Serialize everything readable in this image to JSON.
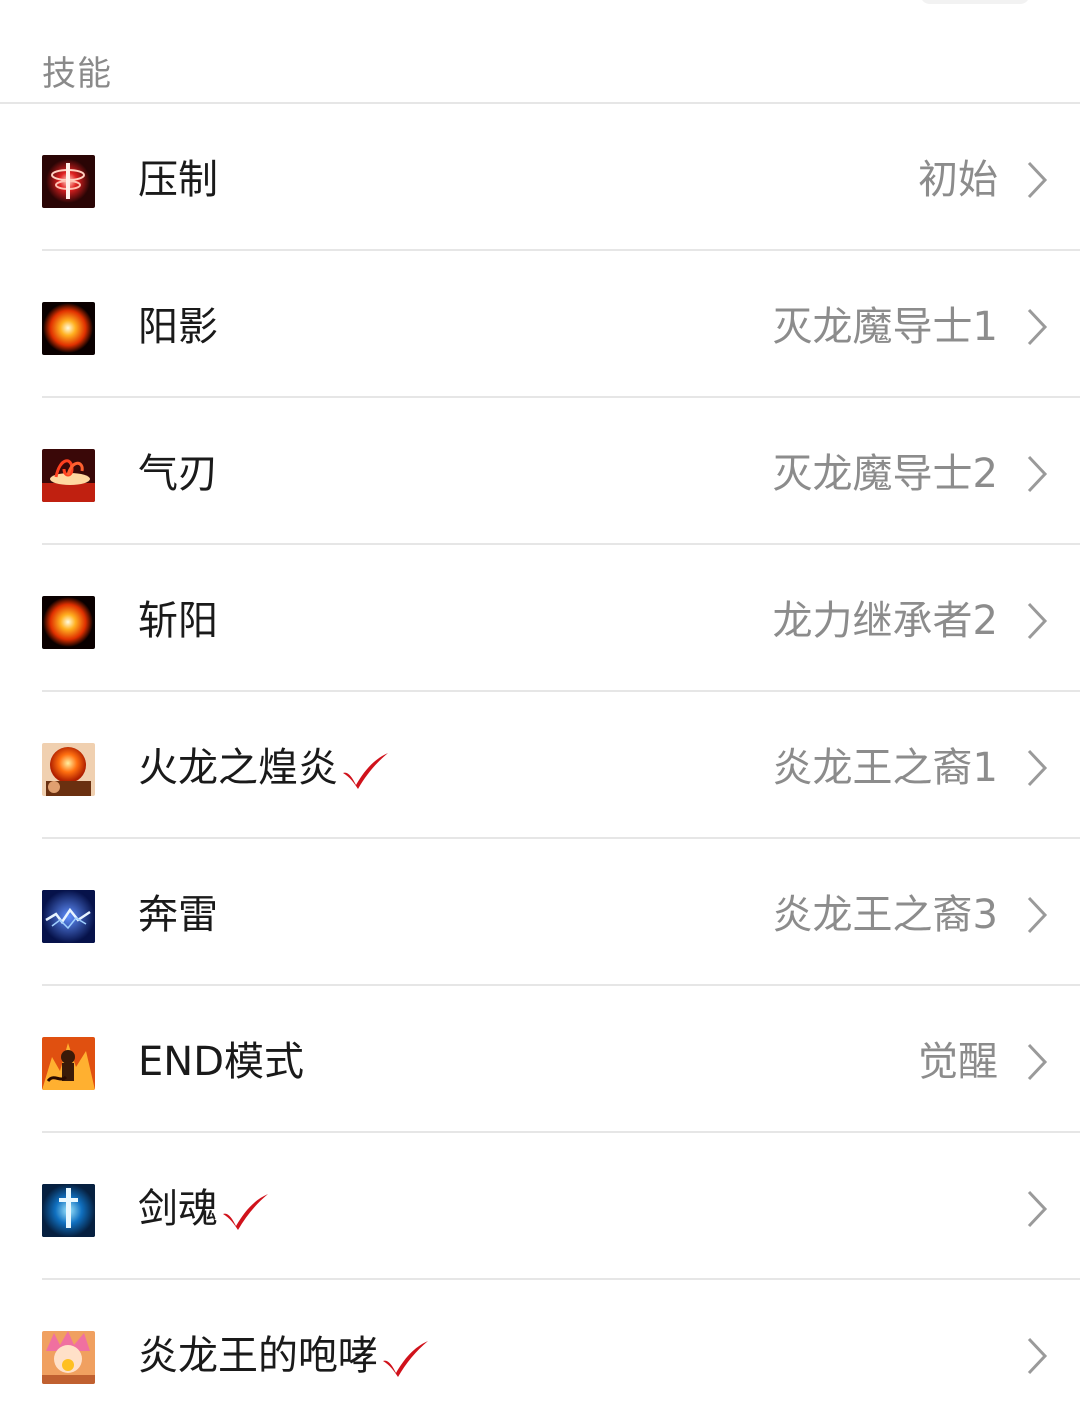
{
  "section": {
    "title": "技能"
  },
  "skills": [
    {
      "name": "压制",
      "source": "初始",
      "icon": "red-vortex-icon",
      "checked": false
    },
    {
      "name": "阳影",
      "source": "灭龙魔导士1",
      "icon": "fire-orb-icon",
      "checked": false
    },
    {
      "name": "气刃",
      "source": "灭龙魔导士2",
      "icon": "air-blade-icon",
      "checked": false
    },
    {
      "name": "斩阳",
      "source": "龙力继承者2",
      "icon": "fire-orb-icon",
      "checked": false
    },
    {
      "name": "火龙之煌炎",
      "source": "炎龙王之裔1",
      "icon": "fire-sphere-icon",
      "checked": true
    },
    {
      "name": "奔雷",
      "source": "炎龙王之裔3",
      "icon": "lightning-icon",
      "checked": false
    },
    {
      "name": "END模式",
      "source": "觉醒",
      "icon": "demon-flame-icon",
      "checked": false
    },
    {
      "name": "剑魂",
      "source": "",
      "icon": "sword-soul-icon",
      "checked": true
    },
    {
      "name": "炎龙王的咆哮",
      "source": "",
      "icon": "natsu-roar-icon",
      "checked": true
    }
  ],
  "colors": {
    "check": "#d0121b",
    "divider": "#e6e6e6",
    "secondary_text": "#8c8c8c"
  }
}
